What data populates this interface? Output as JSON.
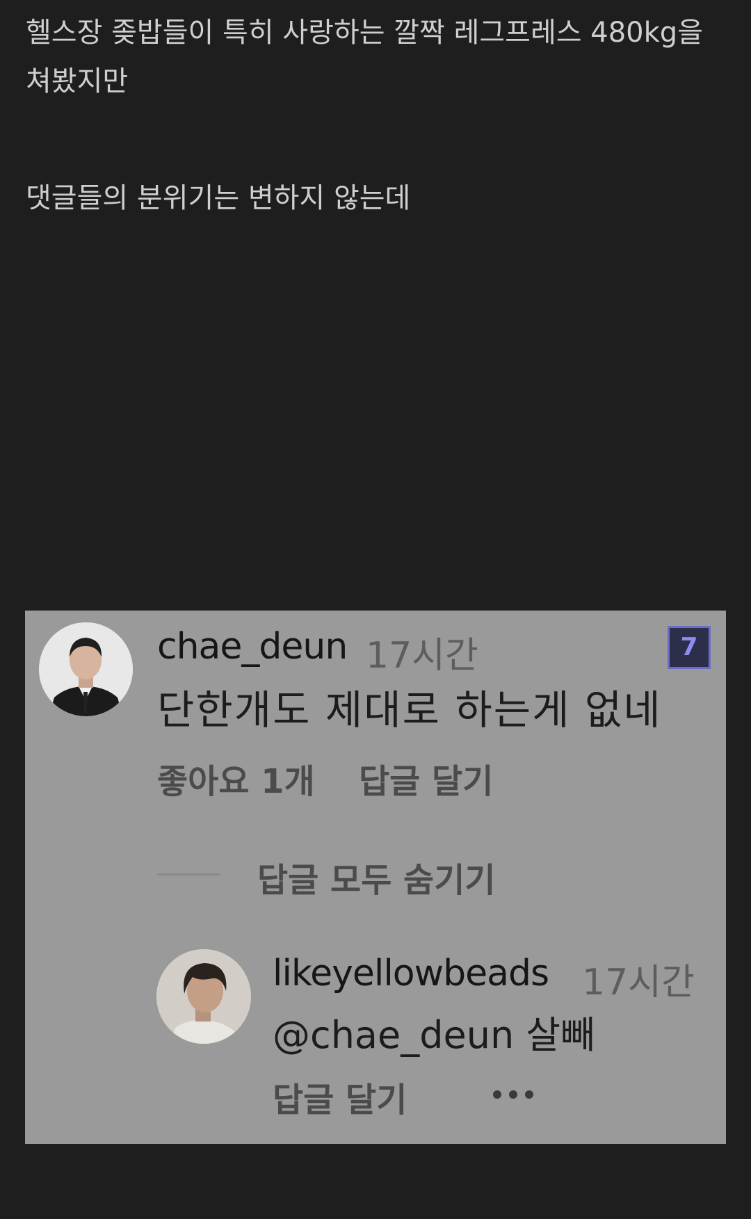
{
  "post": {
    "line1": "헬스장 좆밥들이 특히 사랑하는 깔짝 레그프레스 480kg을 쳐봤지만",
    "line2": "댓글들의 분위기는 변하지 않는데"
  },
  "screenshot": {
    "badge": "7",
    "comment": {
      "username": "chae_deun",
      "time": "17시간",
      "text": "단한개도 제대로 하는게 없네",
      "likes": "좋아요 1개",
      "reply_label": "답글 달기"
    },
    "hide_replies_label": "답글 모두 숨기기",
    "reply": {
      "username": "likeyellowbeads",
      "time": "17시간",
      "text": "@chae_deun 살빼",
      "reply_label": "답글 달기",
      "more_icon": "more-dots-icon"
    }
  }
}
